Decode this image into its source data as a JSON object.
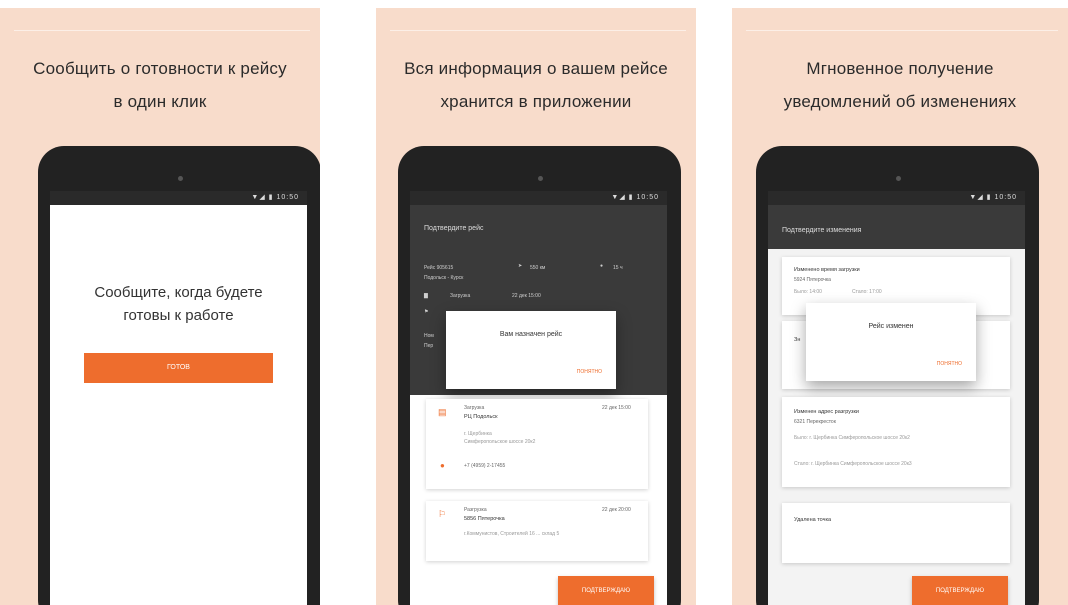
{
  "panels": [
    {
      "title_line1": "Сообщить о готовности к рейсу",
      "title_line2": "в один клик",
      "status": "▼◢ ▮ 10:50",
      "message_line1": "Сообщите, когда будете",
      "message_line2": "готовы к работе",
      "button": "готов"
    },
    {
      "title_line1": "Вся информация о вашем рейсе",
      "title_line2": "хранится в приложении",
      "status": "▼◢ ▮ 10:50",
      "header_title": "Подтвердите рейс",
      "route_no": "Рейс 905615",
      "route_name": "Подольск - Курск",
      "distance": "550 км",
      "duration": "15 ч",
      "loading": "Загрузка",
      "loading_date": "22 дек 15:00",
      "unloading_short": "Разгрузка",
      "dialog_title": "Вам назначен рейс",
      "dialog_button": "Понятно",
      "card1_type": "Загрузка",
      "card1_date": "22 дек 15:00",
      "card1_place": "РЦ Подольск",
      "card1_addr1": "г. Щербинка",
      "card1_addr2": "Симферопольское шоссе 20к2",
      "card1_phone": "+7 (4959) 2-17455",
      "card2_type": "Разгрузка",
      "card2_date": "22 дек 20:00",
      "card2_place": "5856 Пятерочка",
      "card2_addr": "г.Коммунистов, Строителей 16 ... склад 5",
      "confirm_button": "Подтверждаю"
    },
    {
      "title_line1": "Мгновенное получение",
      "title_line2": "уведомлений об изменениях",
      "status": "▼◢ ▮ 10:50",
      "header_title": "Подтвердите изменения",
      "c1_title": "Изменено время загрузки",
      "c1_place": "5924 Пятерочка",
      "c1_was": "Было: 14:00",
      "c1_now": "Стало: 17:00",
      "dialog_title": "Рейс изменен",
      "dialog_button": "Понятно",
      "c2_title": "Изменен адрес разгрузки",
      "c2_place": "6321 Перекресток",
      "c2_was": "Было: г. Щербинка Симферопольское шоссе 20к2",
      "c2_now": "Стало: г. Щербинка Симферопольское шоссе 20к3",
      "c3_title": "Удалена точка",
      "confirm_button": "Подтверждаю"
    }
  ]
}
